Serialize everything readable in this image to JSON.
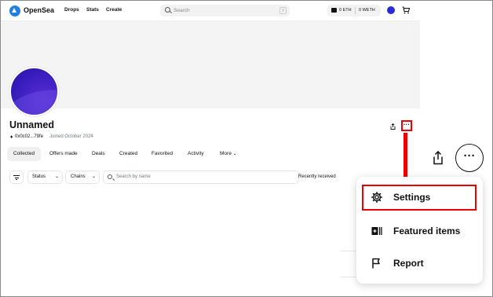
{
  "nav": {
    "brand": "OpenSea",
    "links": [
      "Drops",
      "Stats",
      "Create"
    ],
    "search_placeholder": "Search",
    "search_shortcut": "/",
    "wallet_eth": "0 ETH",
    "wallet_weth": "0 WETH"
  },
  "profile": {
    "name": "Unnamed",
    "address": "0x0c02...79fe",
    "joined": "Joined October 2024"
  },
  "tabs": [
    {
      "label": "Collected",
      "active": true
    },
    {
      "label": "Offers made"
    },
    {
      "label": "Deals"
    },
    {
      "label": "Created"
    },
    {
      "label": "Favorited"
    },
    {
      "label": "Activity"
    },
    {
      "label": "More"
    }
  ],
  "filters": {
    "status": "Status",
    "chains": "Chains",
    "search_placeholder": "Search by name",
    "sort": "Recently received"
  },
  "menu": {
    "items": [
      {
        "label": "Settings",
        "icon": "gear-icon",
        "highlighted": true
      },
      {
        "label": "Featured items",
        "icon": "featured-icon"
      },
      {
        "label": "Report",
        "icon": "flag-icon"
      }
    ]
  },
  "colors": {
    "accent": "#2081e2",
    "annotation": "#ee0000",
    "avatar": "#3b1fc0"
  }
}
